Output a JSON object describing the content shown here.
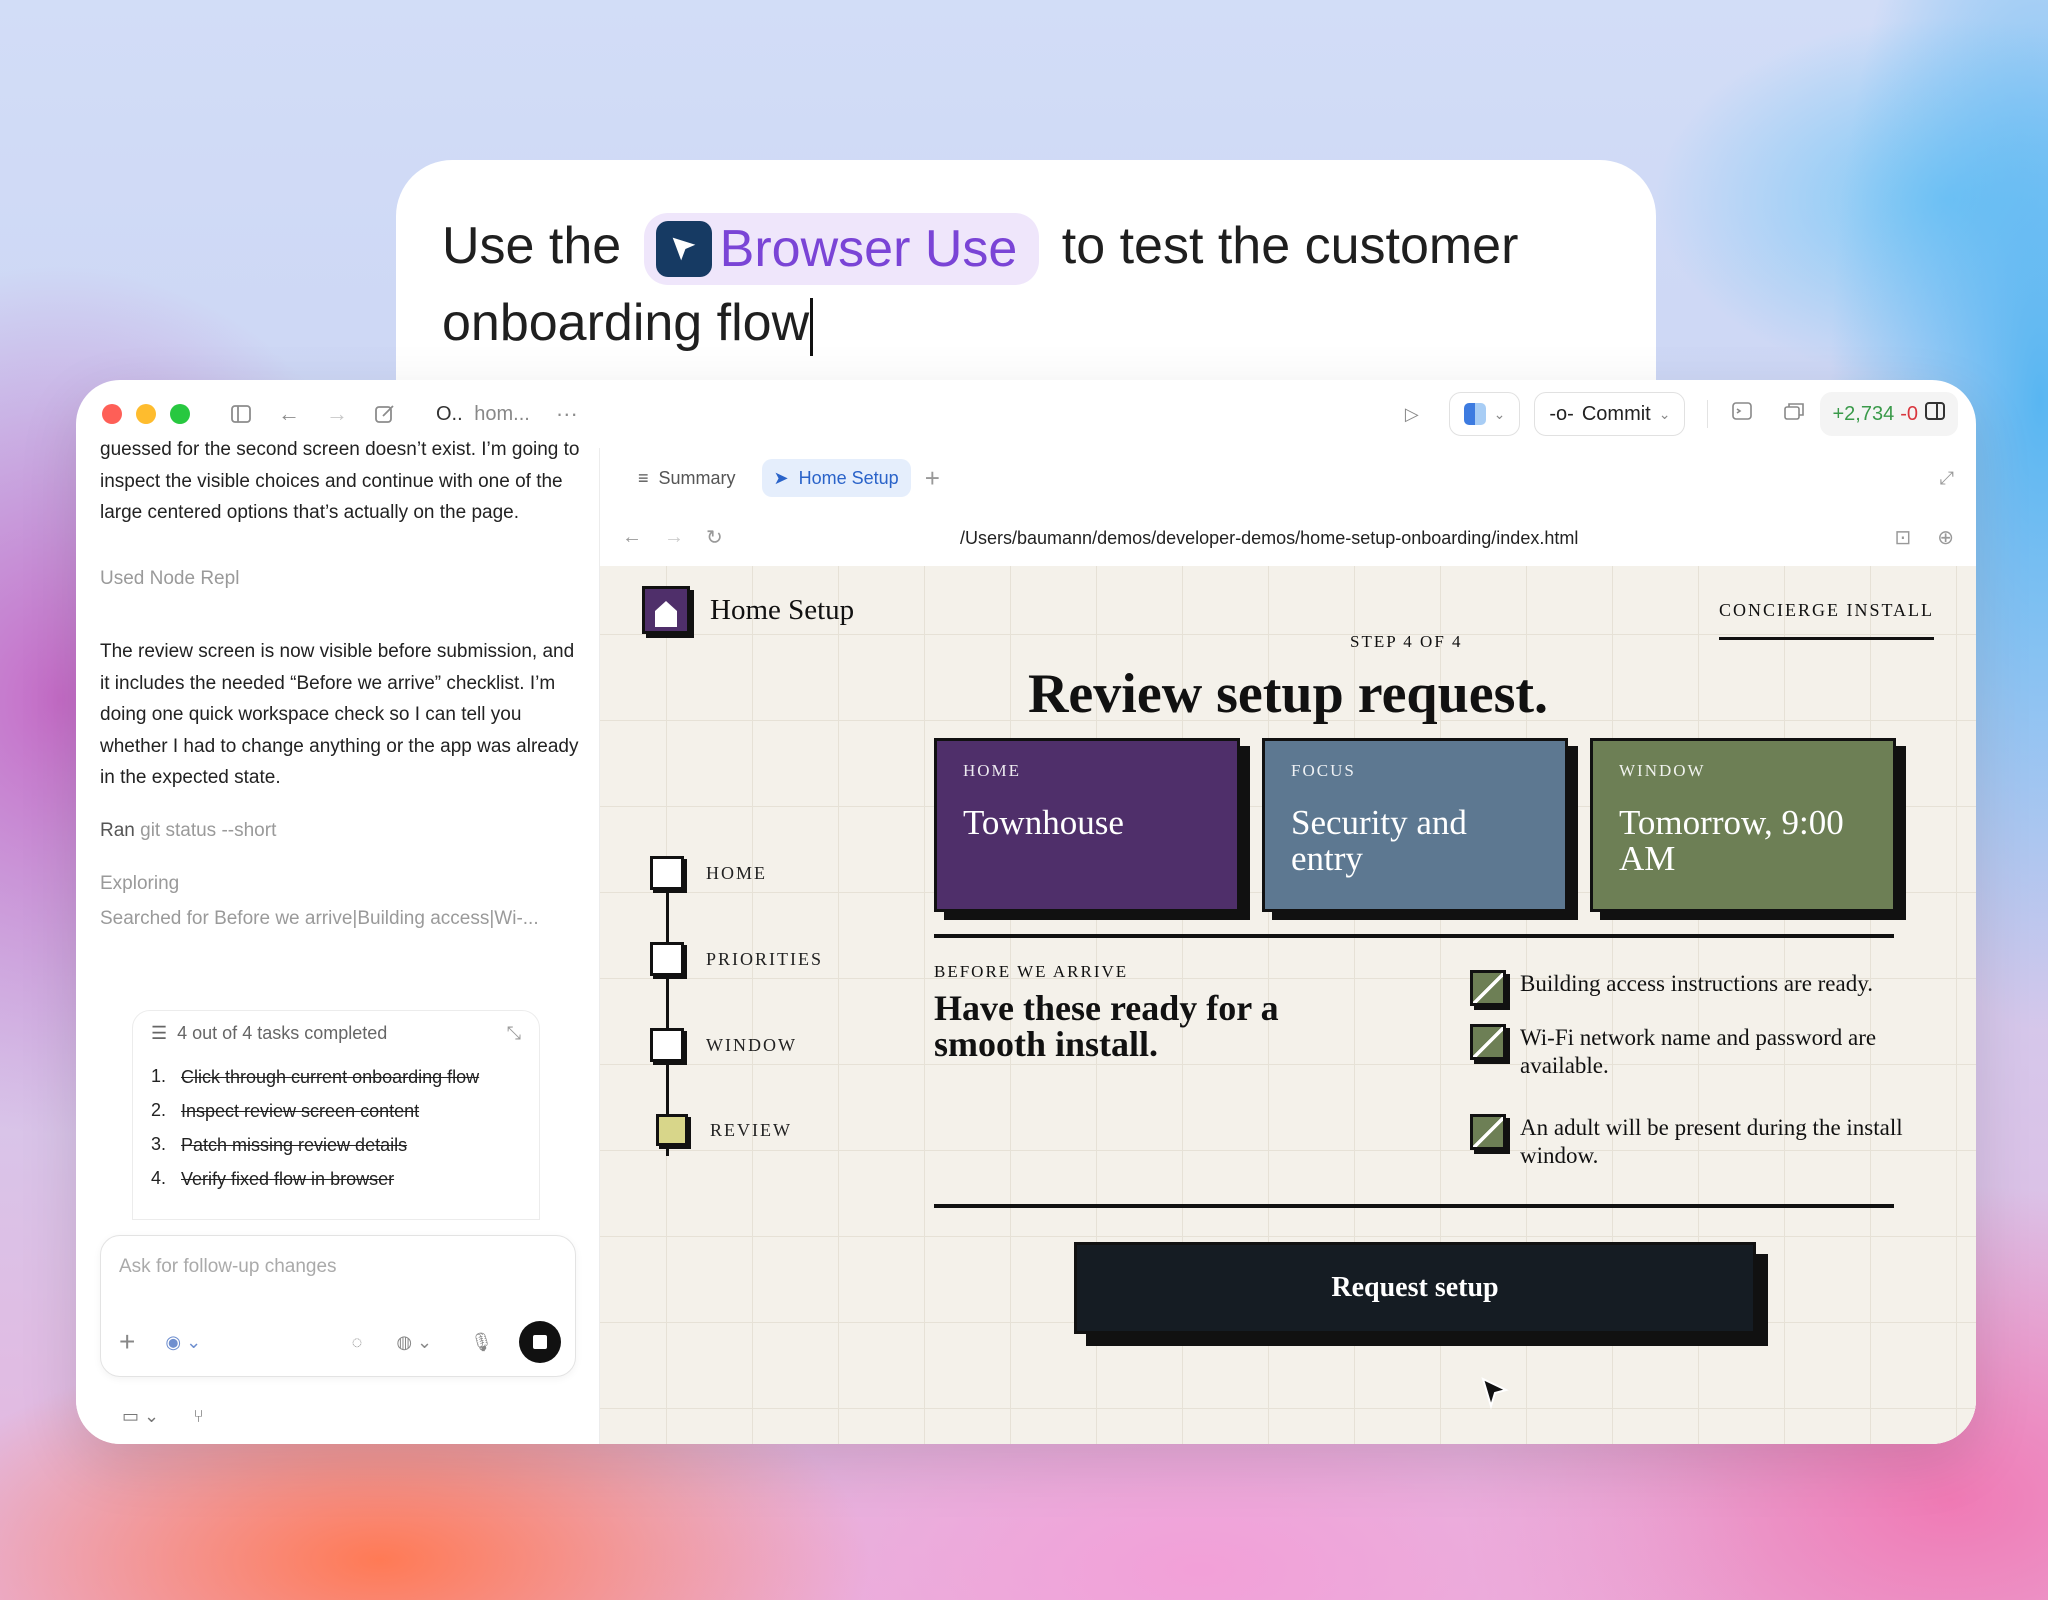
{
  "prompt": {
    "text_before": "Use the",
    "chip_label": "Browser Use",
    "text_after": "to test the customer",
    "line2": "onboarding flow"
  },
  "titlebar": {
    "title_short": "O..",
    "title_dim": "hom...",
    "commit_label": "Commit",
    "additions": "+2,734",
    "deletions": "-0"
  },
  "chat": {
    "msg1": "guessed for the second screen doesn’t exist. I’m going to inspect the visible choices and continue with one of the large centered options that’s actually on the page.",
    "used_tool": "Used Node Repl",
    "msg2": "The review screen is now visible before submission, and it includes the needed “Before we arrive” checklist. I’m doing one quick workspace check so I can tell you whether I had to change anything or the app was already in the expected state.",
    "ran_prefix": "Ran",
    "ran_cmd": "git status --short",
    "exploring": "Exploring",
    "searched": "Searched for Before we arrive|Building access|Wi-...",
    "tasks_header": "4 out of 4 tasks completed",
    "tasks": [
      {
        "num": "1.",
        "text": "Click through current onboarding flow"
      },
      {
        "num": "2.",
        "text": "Inspect review screen content"
      },
      {
        "num": "3.",
        "text": "Patch missing review details"
      },
      {
        "num": "4.",
        "text": "Verify fixed flow in browser"
      }
    ],
    "composer_placeholder": "Ask for follow-up changes"
  },
  "browser": {
    "tab_summary": "Summary",
    "tab_home_setup": "Home Setup",
    "url": "/Users/baumann/demos/developer-demos/home-setup-onboarding/index.html"
  },
  "site": {
    "brand": "Home Setup",
    "concierge": "CONCIERGE INSTALL",
    "step": "STEP 4 OF 4",
    "heading": "Review setup request.",
    "cards": [
      {
        "label": "HOME",
        "value": "Townhouse",
        "color": "#4f2f6a"
      },
      {
        "label": "FOCUS",
        "value": "Security and entry",
        "color": "#5d7891"
      },
      {
        "label": "WINDOW",
        "value": "Tomorrow, 9:00 AM",
        "color": "#6d7f55"
      }
    ],
    "stepper": [
      "HOME",
      "PRIORITIES",
      "WINDOW",
      "REVIEW"
    ],
    "before_label": "BEFORE WE ARRIVE",
    "before_heading": "Have these ready for a smooth install.",
    "checklist": [
      "Building access instructions are ready.",
      "Wi-Fi network name and password are available.",
      "An adult will be present during the install window."
    ],
    "cta": "Request setup"
  }
}
